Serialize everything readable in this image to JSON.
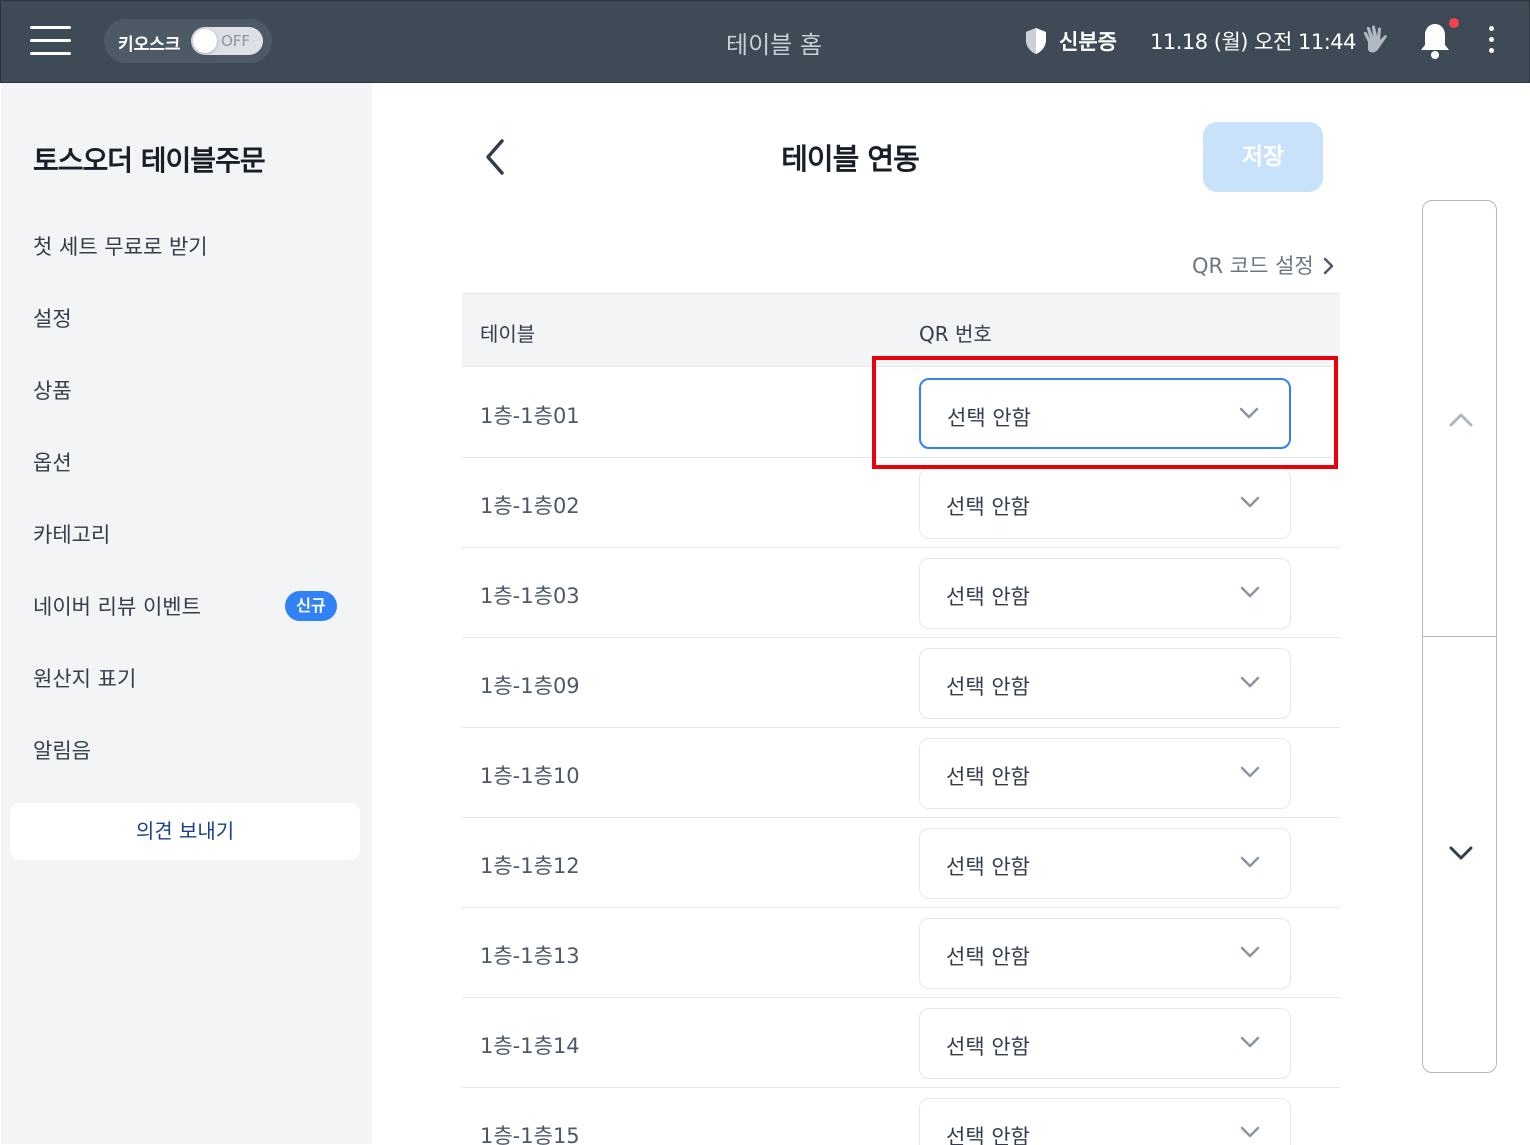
{
  "topbar": {
    "kiosk_label": "키오스크",
    "kiosk_toggle": "OFF",
    "title": "테이블 홈",
    "id_label": "신분증",
    "datetime": "11.18 (월) 오전 11:44"
  },
  "sidebar": {
    "title": "토스오더 테이블주문",
    "items": [
      {
        "label": "첫 세트 무료로 받기"
      },
      {
        "label": "설정"
      },
      {
        "label": "상품"
      },
      {
        "label": "옵션"
      },
      {
        "label": "카테고리"
      },
      {
        "label": "네이버 리뷰 이벤트",
        "badge": "신규"
      },
      {
        "label": "원산지 표기"
      },
      {
        "label": "알림음"
      }
    ],
    "feedback_label": "의견 보내기"
  },
  "main": {
    "title": "테이블 연동",
    "save_label": "저장",
    "qr_link": "QR 코드 설정",
    "table": {
      "headers": [
        "테이블",
        "QR 번호"
      ],
      "rows": [
        {
          "name": "1층-1층01",
          "qr": "선택 안함"
        },
        {
          "name": "1층-1층02",
          "qr": "선택 안함"
        },
        {
          "name": "1층-1층03",
          "qr": "선택 안함"
        },
        {
          "name": "1층-1층09",
          "qr": "선택 안함"
        },
        {
          "name": "1층-1층10",
          "qr": "선택 안함"
        },
        {
          "name": "1층-1층12",
          "qr": "선택 안함"
        },
        {
          "name": "1층-1층13",
          "qr": "선택 안함"
        },
        {
          "name": "1층-1층14",
          "qr": "선택 안함"
        },
        {
          "name": "1층-1층15",
          "qr": "선택 안함"
        }
      ]
    }
  },
  "colors": {
    "topbar": "#3f4a57",
    "accent": "#3182f6",
    "save_disabled": "#c9e2fc",
    "highlight": "#e8000b"
  }
}
